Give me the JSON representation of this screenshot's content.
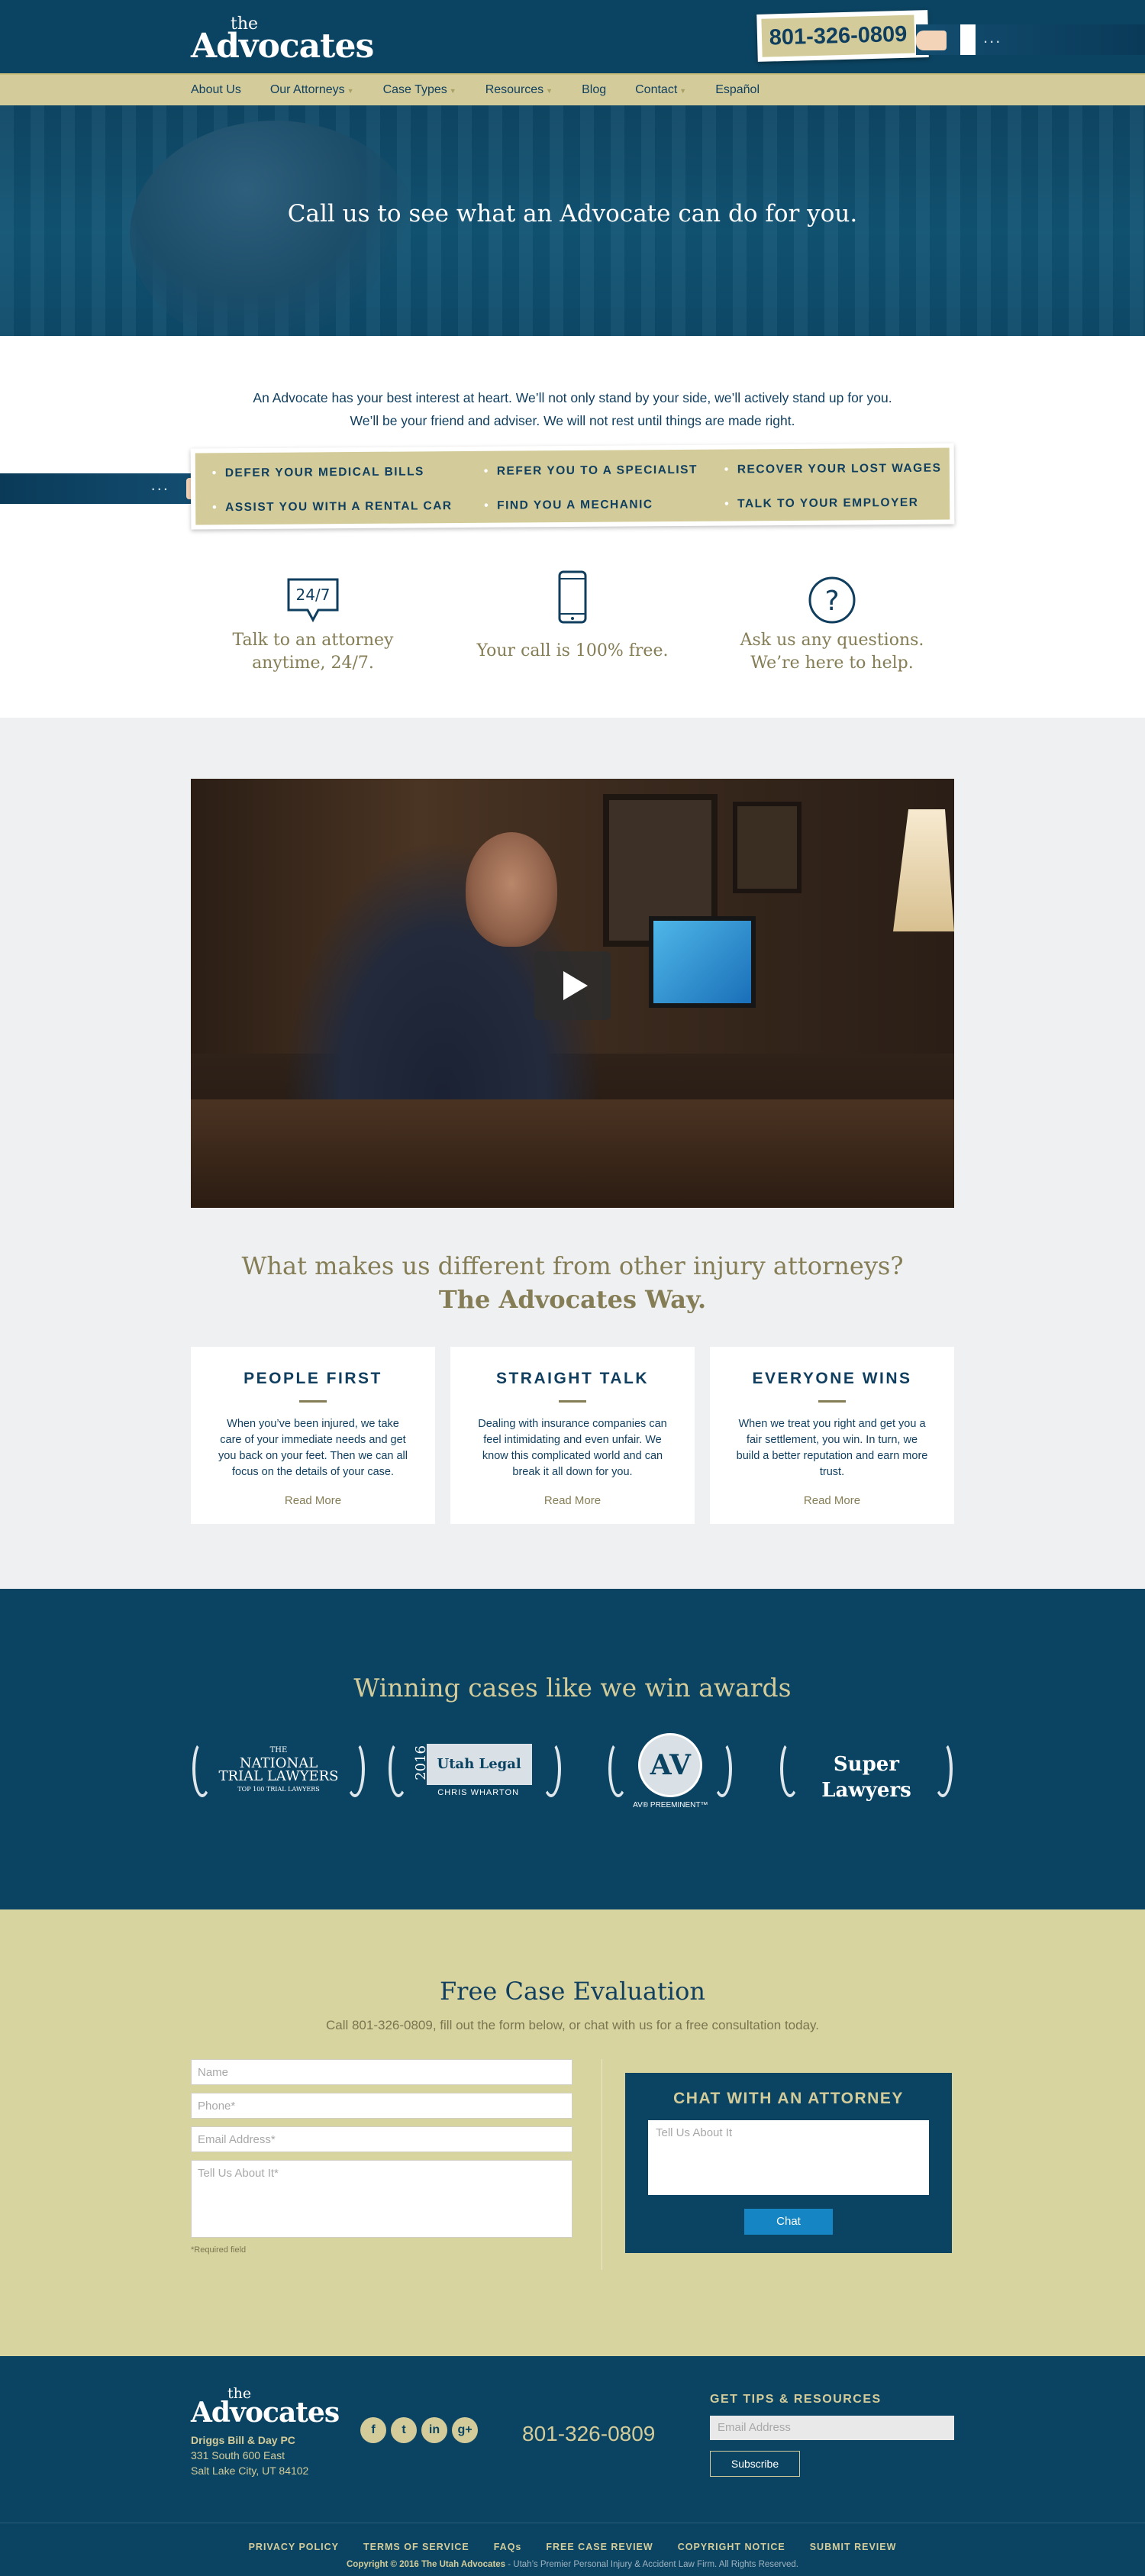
{
  "header": {
    "logo_the": "the",
    "logo_name": "Advocates",
    "phone": "801-326-0809",
    "arm_dots": "..."
  },
  "nav": {
    "items": [
      {
        "label": "About Us",
        "has_caret": false
      },
      {
        "label": "Our Attorneys",
        "has_caret": true
      },
      {
        "label": "Case Types",
        "has_caret": true
      },
      {
        "label": "Resources",
        "has_caret": true
      },
      {
        "label": "Blog",
        "has_caret": false
      },
      {
        "label": "Contact",
        "has_caret": true
      },
      {
        "label": "Español",
        "has_caret": false
      }
    ]
  },
  "hero": {
    "headline": "Call us to see what an Advocate can do for you."
  },
  "intro": {
    "text": "An Advocate has your best interest at heart. We’ll not only stand by your side, we’ll actively stand up for you. We’ll be your friend and adviser. We will not rest until things are made right.",
    "promises": [
      "DEFER YOUR MEDICAL BILLS",
      "REFER YOU TO A SPECIALIST",
      "RECOVER YOUR LOST WAGES",
      "ASSIST YOU WITH A RENTAL CAR",
      "FIND YOU A MECHANIC",
      "TALK TO YOUR EMPLOYER"
    ],
    "arm_dots": "...",
    "features": [
      {
        "icon": "speech-bubble-24-7-icon",
        "icon_text": "24/7",
        "line1": "Talk to an attorney",
        "line2": "anytime, 24/7."
      },
      {
        "icon": "mobile-phone-icon",
        "icon_text": "",
        "line1": "Your call is 100% free.",
        "line2": ""
      },
      {
        "icon": "question-circle-icon",
        "icon_text": "?",
        "line1": "Ask us any questions.",
        "line2": "We’re here to help."
      }
    ]
  },
  "difference": {
    "heading": "What makes us different from other injury attorneys?",
    "subheading": "The Advocates Way.",
    "cards": [
      {
        "title": "PEOPLE FIRST",
        "text": "When you’ve been injured, we take care of your immediate needs and get you back on your feet. Then we can all focus on the details of your case.",
        "more": "Read More"
      },
      {
        "title": "STRAIGHT TALK",
        "text": "Dealing with insurance companies can feel intimidating and even unfair. We know this complicated world and can break it all down for you.",
        "more": "Read More"
      },
      {
        "title": "EVERYONE WINS",
        "text": "When we treat you right and get you a fair settlement, you win. In turn, we build a better reputation and earn more trust.",
        "more": "Read More"
      }
    ]
  },
  "awards": {
    "heading": "Winning cases like we win awards",
    "ntl": {
      "line1": "THE",
      "line2": "NATIONAL",
      "line3": "TRIAL LAWYERS",
      "line4": "TOP 100 TRIAL LAWYERS"
    },
    "elite": {
      "year": "2016",
      "title": "Utah Legal Elite",
      "name": "CHRIS WHARTON"
    },
    "av": {
      "mark": "AV",
      "sub": "AV® PREEMINENT™"
    },
    "super": {
      "text": "Super Lawyers"
    }
  },
  "form": {
    "heading": "Free Case Evaluation",
    "subtext": "Call 801-326-0809, fill out the form below, or chat with us for a free consultation today.",
    "name_placeholder": "Name",
    "phone_placeholder": "Phone*",
    "email_placeholder": "Email Address*",
    "about_placeholder": "Tell Us About It*",
    "required_note": "*Required field",
    "chat_heading": "CHAT WITH AN ATTORNEY",
    "chat_placeholder": "Tell Us About It",
    "chat_button": "Chat"
  },
  "footer": {
    "logo_the": "the",
    "logo_name": "Advocates",
    "firm": "Driggs Bill & Day PC",
    "address1": "331 South 600 East",
    "address2": "Salt Lake City, UT 84102",
    "social": [
      {
        "icon": "facebook-icon",
        "glyph": "f"
      },
      {
        "icon": "twitter-icon",
        "glyph": "t"
      },
      {
        "icon": "linkedin-icon",
        "glyph": "in"
      },
      {
        "icon": "google-plus-icon",
        "glyph": "g+"
      }
    ],
    "phone": "801-326-0809",
    "tips_heading": "GET TIPS & RESOURCES",
    "email_placeholder": "Email Address",
    "subscribe": "Subscribe",
    "links": [
      "PRIVACY POLICY",
      "TERMS OF SERVICE",
      "FAQs",
      "FREE CASE REVIEW",
      "COPYRIGHT NOTICE",
      "SUBMIT REVIEW"
    ],
    "copyright": "Copyright © 2016 The Utah Advocates",
    "copyright_rest": " - Utah’s Premier Personal Injury & Accident Law Firm. All Rights Reserved."
  },
  "colors": {
    "navy": "#0b4462",
    "tan": "#d3cc9a",
    "olive_text": "#857d55",
    "chat_button": "#1586c3"
  }
}
